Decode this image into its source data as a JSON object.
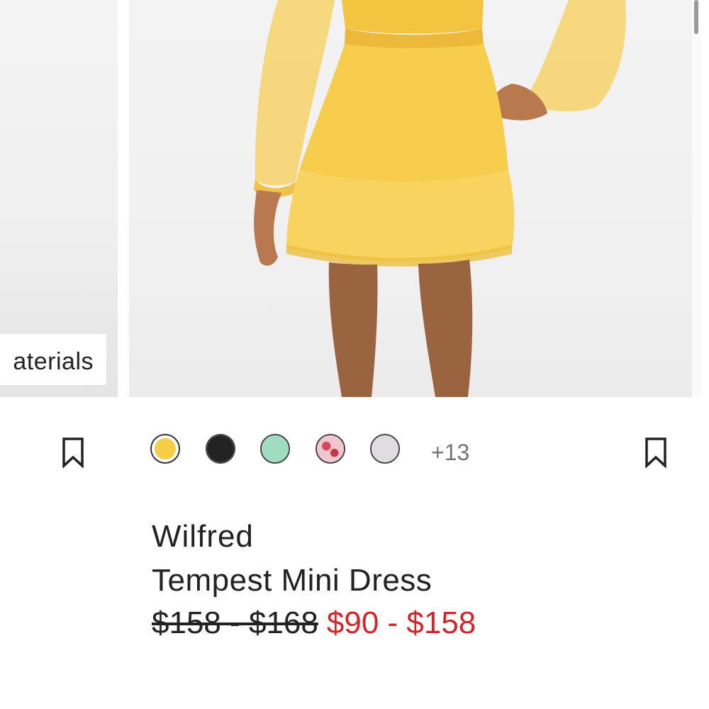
{
  "left_card": {
    "materials_label": "aterials"
  },
  "product": {
    "brand": "Wilfred",
    "name": "Tempest Mini Dress",
    "original_price": "$158 - $168",
    "sale_price": "$90 - $158"
  },
  "swatches": {
    "colors": [
      {
        "name": "yellow",
        "hex": "#f5cd46",
        "selected": true
      },
      {
        "name": "black",
        "hex": "#232323",
        "selected": false
      },
      {
        "name": "mint",
        "hex": "#9fdcc0",
        "selected": false
      },
      {
        "name": "pink-floral",
        "hex": "#e7a4b2",
        "selected": false
      },
      {
        "name": "lavender-grey",
        "hex": "#e1dce3",
        "selected": false
      }
    ],
    "more_label": "+13"
  },
  "icons": {
    "bookmark_left": "bookmark-icon",
    "bookmark_right": "bookmark-icon"
  },
  "colors": {
    "sale_red": "#d0262b",
    "text_dark": "#222222",
    "muted": "#757575"
  }
}
